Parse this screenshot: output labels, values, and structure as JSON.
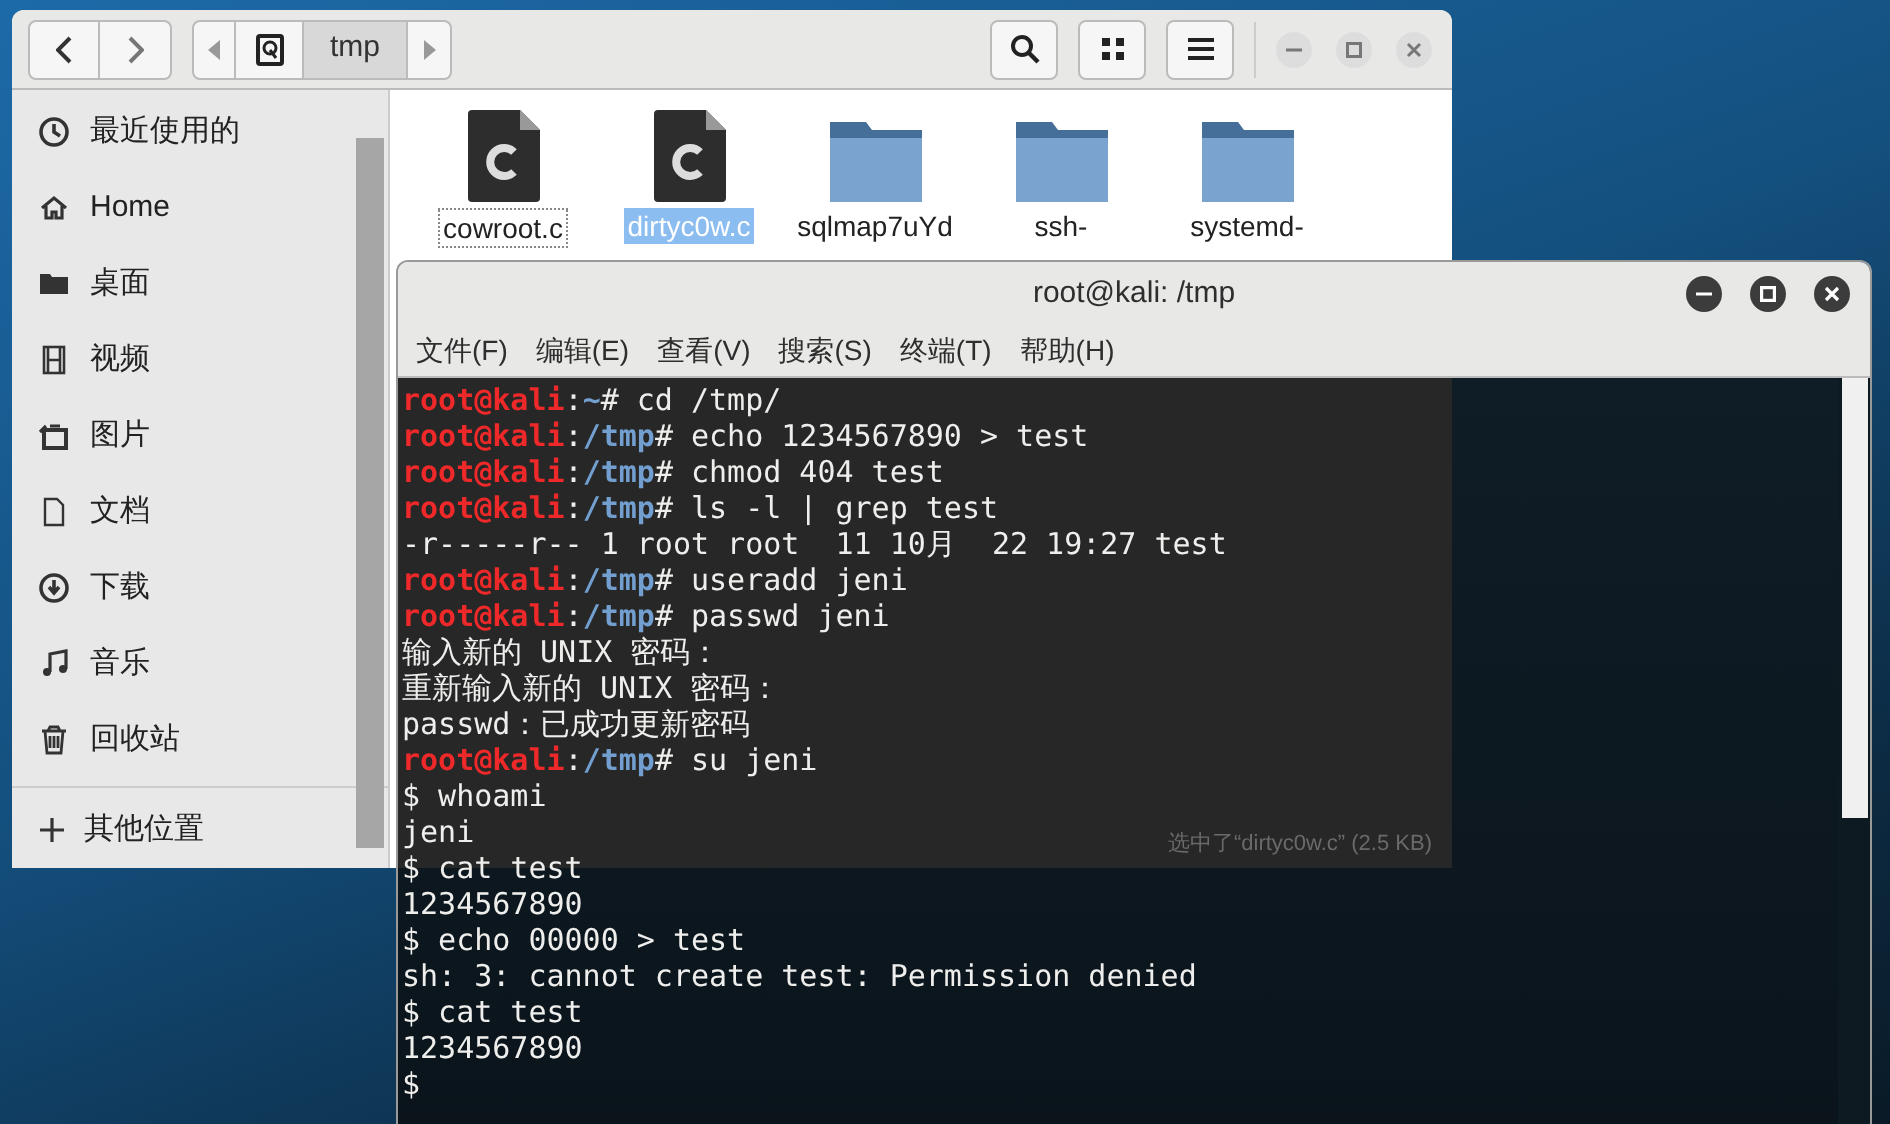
{
  "file_manager": {
    "nav": {
      "path_segment": "tmp"
    },
    "sidebar": {
      "items": [
        {
          "label": "最近使用的"
        },
        {
          "label": "Home"
        },
        {
          "label": "桌面"
        },
        {
          "label": "视频"
        },
        {
          "label": "图片"
        },
        {
          "label": "文档"
        },
        {
          "label": "下载"
        },
        {
          "label": "音乐"
        },
        {
          "label": "回收站"
        }
      ],
      "other": {
        "label": "其他位置"
      }
    },
    "files": [
      {
        "kind": "c-file",
        "name": "cowroot.c",
        "selected": false
      },
      {
        "kind": "c-file",
        "name": "dirtyc0w.c",
        "selected": true
      },
      {
        "kind": "folder",
        "name": "sqlmap7uYd",
        "selected": false
      },
      {
        "kind": "folder",
        "name": "ssh-",
        "selected": false
      },
      {
        "kind": "folder",
        "name": "systemd-",
        "selected": false
      }
    ],
    "status": "选中了“dirtyc0w.c”  (2.5 KB)"
  },
  "terminal": {
    "title": "root@kali: /tmp",
    "menu": [
      "文件(F)",
      "编辑(E)",
      "查看(V)",
      "搜索(S)",
      "终端(T)",
      "帮助(H)"
    ],
    "lines": [
      {
        "kind": "prompt",
        "user": "root@kali",
        "colon": ":",
        "path": "~",
        "command": "# cd /tmp/"
      },
      {
        "kind": "prompt",
        "user": "root@kali",
        "colon": ":",
        "path": "/tmp",
        "command": "# echo 1234567890 > test"
      },
      {
        "kind": "prompt",
        "user": "root@kali",
        "colon": ":",
        "path": "/tmp",
        "command": "# chmod 404 test"
      },
      {
        "kind": "prompt",
        "user": "root@kali",
        "colon": ":",
        "path": "/tmp",
        "command": "# ls -l | grep test"
      },
      {
        "kind": "output",
        "text": "-r-----r-- 1 root root  11 10月  22 19:27 test"
      },
      {
        "kind": "prompt",
        "user": "root@kali",
        "colon": ":",
        "path": "/tmp",
        "command": "# useradd jeni"
      },
      {
        "kind": "prompt",
        "user": "root@kali",
        "colon": ":",
        "path": "/tmp",
        "command": "# passwd jeni"
      },
      {
        "kind": "output",
        "text": "输入新的 UNIX 密码："
      },
      {
        "kind": "output",
        "text": "重新输入新的 UNIX 密码："
      },
      {
        "kind": "output",
        "text": "passwd：已成功更新密码"
      },
      {
        "kind": "prompt",
        "user": "root@kali",
        "colon": ":",
        "path": "/tmp",
        "command": "# su jeni"
      },
      {
        "kind": "output",
        "text": "$ whoami"
      },
      {
        "kind": "output",
        "text": "jeni"
      },
      {
        "kind": "output",
        "text": "$ cat test"
      },
      {
        "kind": "output",
        "text": "1234567890"
      },
      {
        "kind": "output",
        "text": "$ echo 00000 > test"
      },
      {
        "kind": "output",
        "text": "sh: 3: cannot create test: Permission denied"
      },
      {
        "kind": "output",
        "text": "$ cat test"
      },
      {
        "kind": "output",
        "text": "1234567890"
      },
      {
        "kind": "output",
        "text": "$"
      }
    ]
  }
}
